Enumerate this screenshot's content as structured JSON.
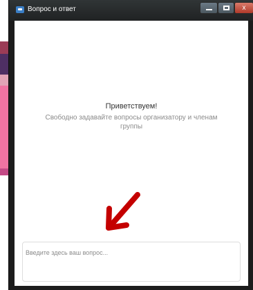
{
  "window": {
    "title": "Вопрос и ответ",
    "controls": {
      "close_label": "x"
    }
  },
  "welcome": {
    "title": "Приветствуем!",
    "subtitle": "Свободно задавайте вопросы организатору и членам группы"
  },
  "question": {
    "placeholder": "Введите здесь ваш вопрос..."
  },
  "colors": {
    "arrow": "#c40000",
    "titlebar": "#2a2d2e",
    "close_button": "#c8503c"
  }
}
